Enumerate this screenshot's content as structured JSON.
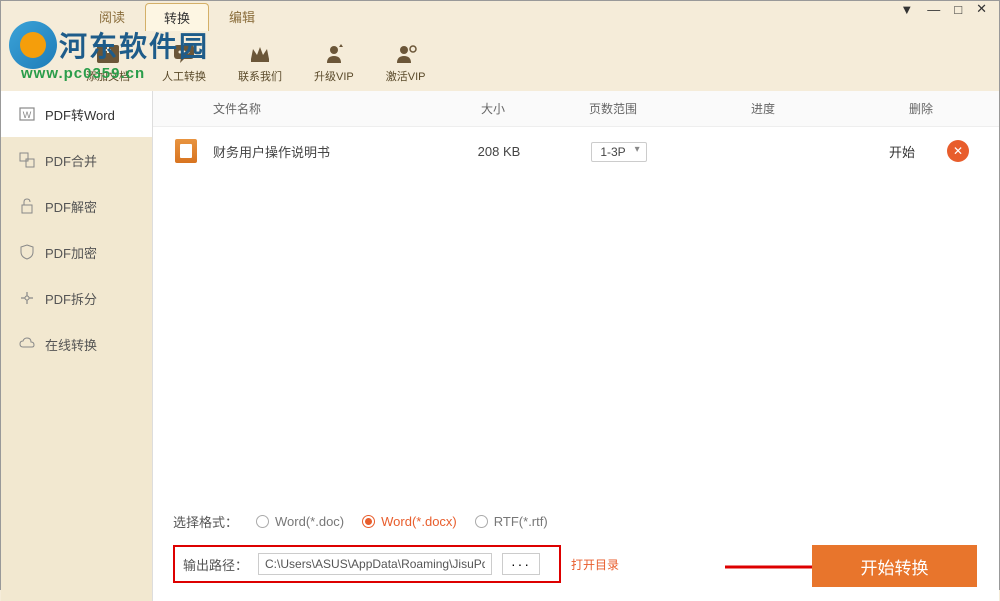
{
  "window": {
    "minimize": "—",
    "tray": "▾",
    "maximize": "□",
    "close": "✕"
  },
  "tabs": {
    "read": "阅读",
    "convert": "转换",
    "edit": "编辑"
  },
  "toolbar": {
    "addDoc": "添加文档",
    "manual": "人工转换",
    "contact": "联系我们",
    "upgrade": "升级VIP",
    "activate": "激活VIP"
  },
  "watermark": {
    "name": "河东软件园",
    "url": "www.pc0359.cn"
  },
  "sidebar": {
    "items": [
      {
        "label": "PDF转Word"
      },
      {
        "label": "PDF合并"
      },
      {
        "label": "PDF解密"
      },
      {
        "label": "PDF加密"
      },
      {
        "label": "PDF拆分"
      },
      {
        "label": "在线转换"
      }
    ]
  },
  "table": {
    "header": {
      "filename": "文件名称",
      "size": "大小",
      "pageRange": "页数范围",
      "progress": "进度",
      "delete": "删除"
    },
    "rows": [
      {
        "filename": "财务用户操作说明书",
        "size": "208 KB",
        "pageRange": "1-3P",
        "action": "开始"
      }
    ]
  },
  "format": {
    "label": "选择格式：",
    "options": [
      {
        "label": "Word(*.doc)"
      },
      {
        "label": "Word(*.docx)"
      },
      {
        "label": "RTF(*.rtf)"
      }
    ]
  },
  "output": {
    "label": "输出路径：",
    "path": "C:\\Users\\ASUS\\AppData\\Roaming\\JisuPd",
    "browse": "···",
    "openDir": "打开目录"
  },
  "convert": {
    "start": "开始转换"
  }
}
